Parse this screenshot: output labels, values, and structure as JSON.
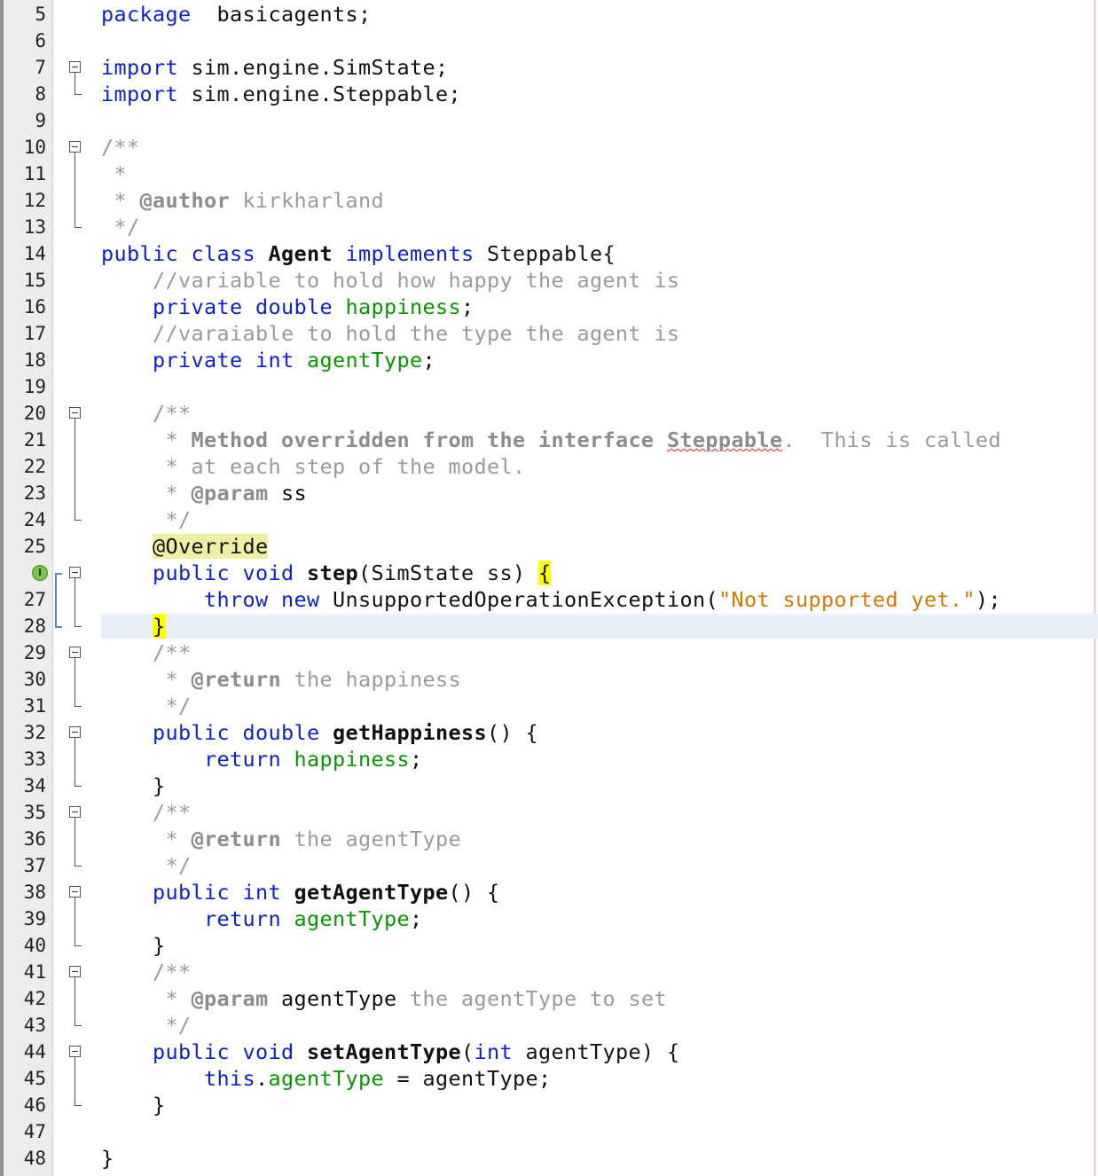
{
  "editor": {
    "lines": [
      {
        "n": "5",
        "tokens": [
          [
            "kw",
            "package"
          ],
          [
            "",
            "  basicagents;"
          ]
        ]
      },
      {
        "n": "6",
        "tokens": []
      },
      {
        "n": "7",
        "tokens": [
          [
            "kw",
            "import"
          ],
          [
            "",
            " sim.engine.SimState;"
          ]
        ]
      },
      {
        "n": "8",
        "tokens": [
          [
            "kw",
            "import"
          ],
          [
            "",
            " sim.engine.Steppable;"
          ]
        ]
      },
      {
        "n": "9",
        "tokens": []
      },
      {
        "n": "10",
        "tokens": [
          [
            "cm",
            "/**"
          ]
        ]
      },
      {
        "n": "11",
        "tokens": [
          [
            "cm",
            " *"
          ]
        ]
      },
      {
        "n": "12",
        "tokens": [
          [
            "cm",
            " * "
          ],
          [
            "tag",
            "@author"
          ],
          [
            "cm",
            " kirkharland"
          ]
        ]
      },
      {
        "n": "13",
        "tokens": [
          [
            "cm",
            " */"
          ]
        ]
      },
      {
        "n": "14",
        "tokens": [
          [
            "kw",
            "public"
          ],
          [
            "",
            " "
          ],
          [
            "kw",
            "class"
          ],
          [
            "",
            " "
          ],
          [
            "b",
            "Agent"
          ],
          [
            "",
            " "
          ],
          [
            "kw",
            "implements"
          ],
          [
            "",
            " Steppable{"
          ]
        ]
      },
      {
        "n": "15",
        "tokens": [
          [
            "",
            "    "
          ],
          [
            "cm",
            "//variable to hold how happy the agent is"
          ]
        ]
      },
      {
        "n": "16",
        "tokens": [
          [
            "",
            "    "
          ],
          [
            "kw",
            "private"
          ],
          [
            "",
            " "
          ],
          [
            "kw",
            "double"
          ],
          [
            "",
            " "
          ],
          [
            "fld",
            "happiness"
          ],
          [
            "",
            ";"
          ]
        ]
      },
      {
        "n": "17",
        "tokens": [
          [
            "",
            "    "
          ],
          [
            "cm",
            "//varaiable to hold the type the agent is"
          ]
        ]
      },
      {
        "n": "18",
        "tokens": [
          [
            "",
            "    "
          ],
          [
            "kw",
            "private"
          ],
          [
            "",
            " "
          ],
          [
            "kw",
            "int"
          ],
          [
            "",
            " "
          ],
          [
            "fld",
            "agentType"
          ],
          [
            "",
            ";"
          ]
        ]
      },
      {
        "n": "19",
        "tokens": []
      },
      {
        "n": "20",
        "tokens": [
          [
            "",
            "    "
          ],
          [
            "cm",
            "/**"
          ]
        ]
      },
      {
        "n": "21",
        "tokens": [
          [
            "",
            "    "
          ],
          [
            "cm",
            " * "
          ],
          [
            "tag",
            "Method overridden from the interface "
          ],
          [
            "tag squig",
            "Steppable"
          ],
          [
            "cm",
            ".  This is called"
          ]
        ]
      },
      {
        "n": "22",
        "tokens": [
          [
            "",
            "    "
          ],
          [
            "cm",
            " * at each step of the model."
          ]
        ]
      },
      {
        "n": "23",
        "tokens": [
          [
            "",
            "    "
          ],
          [
            "cm",
            " * "
          ],
          [
            "tag",
            "@param"
          ],
          [
            "",
            " ss"
          ]
        ]
      },
      {
        "n": "24",
        "tokens": [
          [
            "",
            "    "
          ],
          [
            "cm",
            " */"
          ]
        ]
      },
      {
        "n": "25",
        "tokens": [
          [
            "",
            "    "
          ],
          [
            "ann",
            "@Override"
          ]
        ]
      },
      {
        "n": "",
        "tokens": [
          [
            "",
            "    "
          ],
          [
            "kw",
            "public"
          ],
          [
            "",
            " "
          ],
          [
            "kw",
            "void"
          ],
          [
            "",
            " "
          ],
          [
            "b",
            "step"
          ],
          [
            "",
            "(SimState ss) "
          ],
          [
            "brace",
            "{"
          ]
        ]
      },
      {
        "n": "27",
        "tokens": [
          [
            "",
            "        "
          ],
          [
            "kw",
            "throw"
          ],
          [
            "",
            " "
          ],
          [
            "kw",
            "new"
          ],
          [
            "",
            " UnsupportedOperationException("
          ],
          [
            "str",
            "\"Not supported yet.\""
          ],
          [
            "",
            ");"
          ]
        ]
      },
      {
        "n": "28",
        "tokens": [
          [
            "",
            "    "
          ],
          [
            "brace",
            "}"
          ]
        ]
      },
      {
        "n": "29",
        "tokens": [
          [
            "",
            "    "
          ],
          [
            "cm",
            "/**"
          ]
        ]
      },
      {
        "n": "30",
        "tokens": [
          [
            "",
            "    "
          ],
          [
            "cm",
            " * "
          ],
          [
            "tag",
            "@return"
          ],
          [
            "cm",
            " the happiness"
          ]
        ]
      },
      {
        "n": "31",
        "tokens": [
          [
            "",
            "    "
          ],
          [
            "cm",
            " */"
          ]
        ]
      },
      {
        "n": "32",
        "tokens": [
          [
            "",
            "    "
          ],
          [
            "kw",
            "public"
          ],
          [
            "",
            " "
          ],
          [
            "kw",
            "double"
          ],
          [
            "",
            " "
          ],
          [
            "b",
            "getHappiness"
          ],
          [
            "",
            "() {"
          ]
        ]
      },
      {
        "n": "33",
        "tokens": [
          [
            "",
            "        "
          ],
          [
            "kw",
            "return"
          ],
          [
            "",
            " "
          ],
          [
            "fld",
            "happiness"
          ],
          [
            "",
            ";"
          ]
        ]
      },
      {
        "n": "34",
        "tokens": [
          [
            "",
            "    }"
          ]
        ]
      },
      {
        "n": "35",
        "tokens": [
          [
            "",
            "    "
          ],
          [
            "cm",
            "/**"
          ]
        ]
      },
      {
        "n": "36",
        "tokens": [
          [
            "",
            "    "
          ],
          [
            "cm",
            " * "
          ],
          [
            "tag",
            "@return"
          ],
          [
            "cm",
            " the agentType"
          ]
        ]
      },
      {
        "n": "37",
        "tokens": [
          [
            "",
            "    "
          ],
          [
            "cm",
            " */"
          ]
        ]
      },
      {
        "n": "38",
        "tokens": [
          [
            "",
            "    "
          ],
          [
            "kw",
            "public"
          ],
          [
            "",
            " "
          ],
          [
            "kw",
            "int"
          ],
          [
            "",
            " "
          ],
          [
            "b",
            "getAgentType"
          ],
          [
            "",
            "() {"
          ]
        ]
      },
      {
        "n": "39",
        "tokens": [
          [
            "",
            "        "
          ],
          [
            "kw",
            "return"
          ],
          [
            "",
            " "
          ],
          [
            "fld",
            "agentType"
          ],
          [
            "",
            ";"
          ]
        ]
      },
      {
        "n": "40",
        "tokens": [
          [
            "",
            "    }"
          ]
        ]
      },
      {
        "n": "41",
        "tokens": [
          [
            "",
            "    "
          ],
          [
            "cm",
            "/**"
          ]
        ]
      },
      {
        "n": "42",
        "tokens": [
          [
            "",
            "    "
          ],
          [
            "cm",
            " * "
          ],
          [
            "tag",
            "@param"
          ],
          [
            "",
            " agentType"
          ],
          [
            "cm",
            " the agentType to set"
          ]
        ]
      },
      {
        "n": "43",
        "tokens": [
          [
            "",
            "    "
          ],
          [
            "cm",
            " */"
          ]
        ]
      },
      {
        "n": "44",
        "tokens": [
          [
            "",
            "    "
          ],
          [
            "kw",
            "public"
          ],
          [
            "",
            " "
          ],
          [
            "kw",
            "void"
          ],
          [
            "",
            " "
          ],
          [
            "b",
            "setAgentType"
          ],
          [
            "",
            "("
          ],
          [
            "kw",
            "int"
          ],
          [
            "",
            " agentType) {"
          ]
        ]
      },
      {
        "n": "45",
        "tokens": [
          [
            "",
            "        "
          ],
          [
            "kw",
            "this"
          ],
          [
            "",
            "."
          ],
          [
            "fld",
            "agentType"
          ],
          [
            "",
            " = agentType;"
          ]
        ]
      },
      {
        "n": "46",
        "tokens": [
          [
            "",
            "    }"
          ]
        ]
      },
      {
        "n": "47",
        "tokens": []
      },
      {
        "n": "48",
        "tokens": [
          [
            "",
            "}"
          ]
        ]
      }
    ],
    "current_line_index": 23,
    "implements_icon_label": "I",
    "colors": {
      "keyword": "#0e1fd0",
      "field": "#079600",
      "string": "#ce7b00",
      "comment": "#9a9a9a",
      "current_line": "#e9eff8",
      "brace_match": "#ffff00",
      "annotation_bg": "#efefa4"
    }
  }
}
